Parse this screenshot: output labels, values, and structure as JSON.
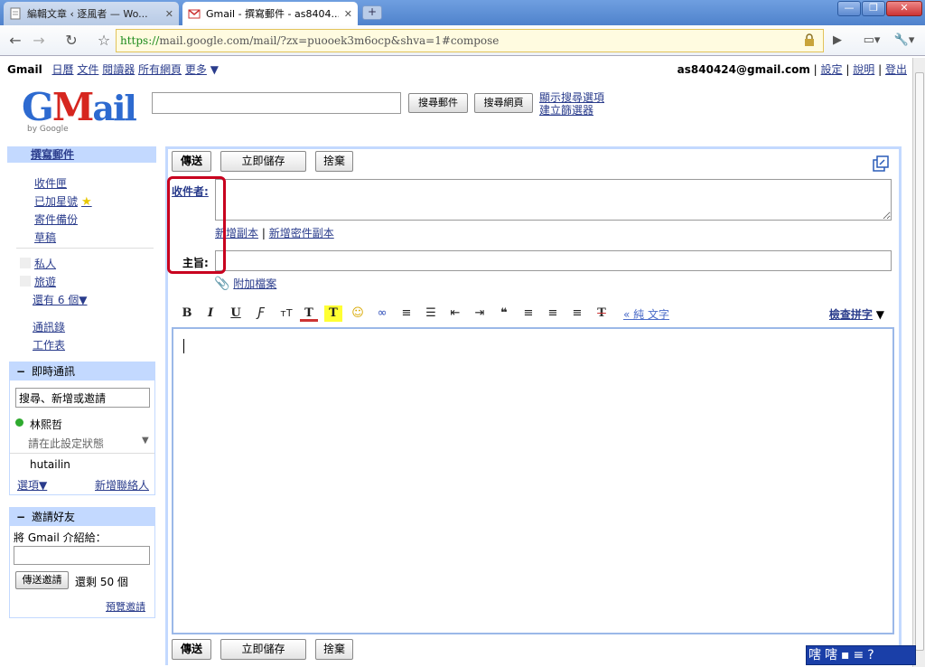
{
  "browser": {
    "tabs": [
      {
        "title": "編輯文章 ‹ 逐風者 — Wo...",
        "active": false
      },
      {
        "title": "Gmail - 撰寫郵件 - as8404...",
        "active": true
      }
    ],
    "new_tab": "+",
    "url_scheme": "https://",
    "url_rest": "mail.google.com/mail/?zx=puooek3m6ocp&shva=1#compose"
  },
  "gbar": {
    "brand": "Gmail",
    "links": [
      "日曆",
      "文件",
      "閱讀器",
      "所有網頁",
      "更多"
    ],
    "more_arrow": "▼",
    "email": "as840424@gmail.com",
    "right_links": [
      "設定",
      "說明",
      "登出"
    ],
    "sep": "|"
  },
  "logo": {
    "text_g": "G",
    "text_m": "M",
    "text_ail": "ail",
    "by": "by Google"
  },
  "search": {
    "search_mail": "搜尋郵件",
    "search_web": "搜尋網頁",
    "show_options": "顯示搜尋選項",
    "create_filter": "建立篩選器"
  },
  "nav": {
    "compose": "撰寫郵件",
    "items": [
      "收件匣",
      "已加星號",
      "寄件備份",
      "草稿"
    ],
    "labels": [
      "私人",
      "旅遊"
    ],
    "more_labels": "還有 6 個▼",
    "extra": [
      "通訊錄",
      "工作表"
    ]
  },
  "chat": {
    "title": "即時通訊",
    "minus": "−",
    "search_placeholder": "搜尋、新增或邀請",
    "user": "林熙哲",
    "status": "請在此設定狀態",
    "status_arrow": "▼",
    "contact": "hutailin",
    "options": "選項▼",
    "add_contact": "新增聯絡人"
  },
  "invite": {
    "title": "邀請好友",
    "minus": "−",
    "prompt": "將 Gmail 介紹給：",
    "send_button": "傳送邀請",
    "remaining": "還剩 50 個",
    "preview": "預覽邀請"
  },
  "compose": {
    "send": "傳送",
    "save_now": "立即儲存",
    "discard": "捨棄",
    "to_label": "收件者:",
    "add_cc": "新增副本",
    "add_bcc": "新增密件副本",
    "cc_sep": "|",
    "subject_label": "主旨:",
    "attach": "附加檔案",
    "plain_text": "« 純 文字",
    "spell_check": "檢查拼字",
    "spell_arrow": "▼"
  },
  "format_icons": [
    {
      "name": "bold-icon",
      "glyph": "B"
    },
    {
      "name": "italic-icon",
      "glyph": "I"
    },
    {
      "name": "underline-icon",
      "glyph": "U"
    },
    {
      "name": "font-icon",
      "glyph": "Ƒ"
    },
    {
      "name": "font-size-icon",
      "glyph": "тT"
    },
    {
      "name": "text-color-icon",
      "glyph": "T"
    },
    {
      "name": "highlight-color-icon",
      "glyph": "T"
    },
    {
      "name": "emoticon-icon",
      "glyph": "☺"
    },
    {
      "name": "link-icon",
      "glyph": "∞"
    },
    {
      "name": "numbered-list-icon",
      "glyph": "≡"
    },
    {
      "name": "bullet-list-icon",
      "glyph": "☰"
    },
    {
      "name": "outdent-icon",
      "glyph": "⇤"
    },
    {
      "name": "indent-icon",
      "glyph": "⇥"
    },
    {
      "name": "quote-icon",
      "glyph": "❝"
    },
    {
      "name": "align-left-icon",
      "glyph": "≡"
    },
    {
      "name": "align-center-icon",
      "glyph": "≡"
    },
    {
      "name": "align-right-icon",
      "glyph": "≡"
    },
    {
      "name": "remove-format-icon",
      "glyph": "T"
    }
  ],
  "ime": {
    "items": [
      "嗐",
      "嗐",
      "▪",
      "≡",
      "?"
    ]
  },
  "colors": {
    "gmail_blue": "#c3d9ff",
    "link": "#2a3c8c",
    "highlight_red": "#c8001e"
  }
}
